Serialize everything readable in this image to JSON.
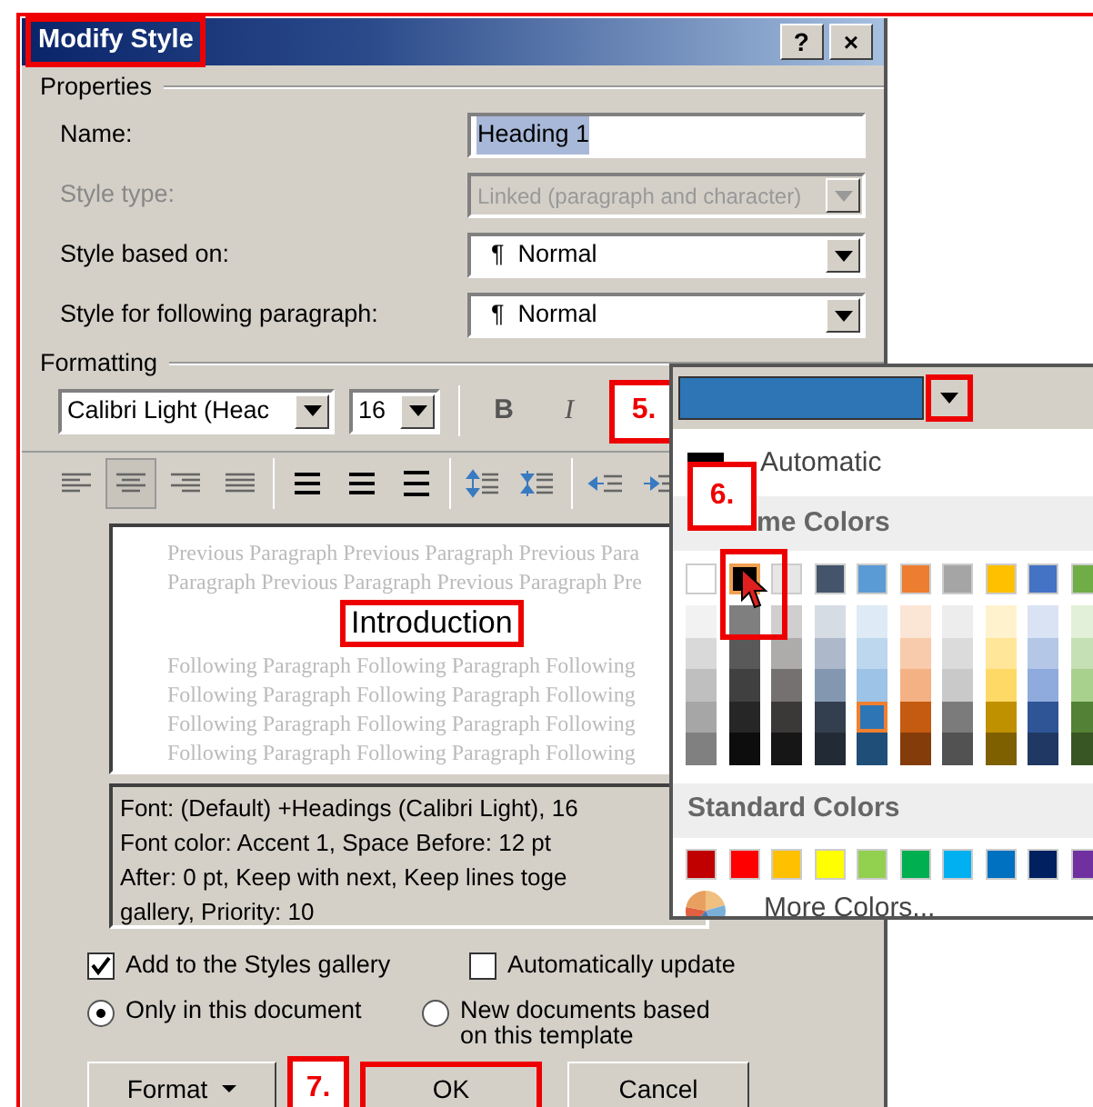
{
  "window": {
    "title": "Modify Style",
    "highlighted": true,
    "help_label": "?",
    "close_label": "×"
  },
  "properties": {
    "label": "Properties",
    "fields": [
      {
        "label": "Name:",
        "kind": "text",
        "value": "Heading 1",
        "disabled": false,
        "selected_text": true
      },
      {
        "label": "Style type:",
        "kind": "combo",
        "value": "Linked (paragraph and character)",
        "disabled": true
      },
      {
        "label": "Style based on:",
        "kind": "combo",
        "prefix": "¶",
        "value": "Normal",
        "disabled": false
      },
      {
        "label": "Style for following paragraph:",
        "kind": "combo",
        "prefix": "¶",
        "value": "Normal",
        "disabled": false
      }
    ]
  },
  "formatting": {
    "label": "Formatting",
    "font": "Calibri Light (Heac",
    "size": "16",
    "bold_label": "B",
    "italic_label": "I",
    "step_label": "5.",
    "tools": [
      {
        "kind": "align-left",
        "selected": false
      },
      {
        "kind": "align-center",
        "selected": true
      },
      {
        "kind": "align-right",
        "selected": false
      },
      {
        "kind": "justify",
        "selected": false
      },
      {
        "kind": "sep"
      },
      {
        "kind": "single-space",
        "selected": false
      },
      {
        "kind": "one-half-space",
        "selected": false
      },
      {
        "kind": "double-space",
        "selected": false
      },
      {
        "kind": "sep"
      },
      {
        "kind": "space-up",
        "selected": false
      },
      {
        "kind": "space-down",
        "selected": false
      },
      {
        "kind": "sep"
      },
      {
        "kind": "outdent",
        "selected": false
      },
      {
        "kind": "indent",
        "selected": false
      }
    ]
  },
  "preview": {
    "lines": [
      {
        "kind": "previous",
        "text": "Previous Paragraph Previous Paragraph Previous Para"
      },
      {
        "kind": "previous",
        "text": "Paragraph Previous Paragraph Previous Paragraph Pre"
      },
      {
        "kind": "heading",
        "text": "Introduction",
        "highlighted": true
      },
      {
        "kind": "following",
        "text": "Following Paragraph Following Paragraph Following"
      },
      {
        "kind": "following",
        "text": "Following Paragraph Following Paragraph Following"
      },
      {
        "kind": "following",
        "text": "Following Paragraph Following Paragraph Following"
      },
      {
        "kind": "following",
        "text": "Following Paragraph Following Paragraph Following"
      }
    ]
  },
  "description": [
    "Font: (Default) +Headings (Calibri Light), 16",
    "Font color: Accent 1, Space Before:  12 pt",
    "After:  0 pt, Keep with next, Keep lines toge",
    "gallery, Priority: 10"
  ],
  "checkboxes": [
    {
      "label": "Add to the Styles gallery",
      "checked": true
    },
    {
      "label": "Automatically update",
      "checked": false
    }
  ],
  "radios": [
    {
      "label": "Only in this document",
      "selected": true
    },
    {
      "label": "New documents based on this template",
      "selected": false
    }
  ],
  "buttons": [
    {
      "label": "Format",
      "kind": "menu",
      "highlighted": false
    },
    {
      "label": "OK",
      "kind": "default",
      "highlighted": true
    },
    {
      "label": "Cancel",
      "kind": "plain",
      "highlighted": false
    }
  ],
  "step_7_label": "7.",
  "color_popup": {
    "dropdown_highlighted": true,
    "automatic_label": "Automatic",
    "step_label": "6.",
    "theme_header": "me Colors",
    "theme_colors": [
      {
        "color": "#ffffff",
        "hovered": false,
        "shades": [
          {
            "color": "#f2f2f2",
            "selected": false
          },
          {
            "color": "#d9d9d9",
            "selected": false
          },
          {
            "color": "#bfbfbf",
            "selected": false
          },
          {
            "color": "#a6a6a6",
            "selected": false
          },
          {
            "color": "#808080",
            "selected": false
          }
        ]
      },
      {
        "color": "#000000",
        "hovered": true,
        "shades": [
          {
            "color": "#7f7f7f",
            "selected": false
          },
          {
            "color": "#595959",
            "selected": false
          },
          {
            "color": "#404040",
            "selected": false
          },
          {
            "color": "#262626",
            "selected": false
          },
          {
            "color": "#0d0d0d",
            "selected": false
          }
        ]
      },
      {
        "color": "#e7e6e6",
        "hovered": false,
        "shades": [
          {
            "color": "#d0cece",
            "selected": false
          },
          {
            "color": "#aeabab",
            "selected": false
          },
          {
            "color": "#757171",
            "selected": false
          },
          {
            "color": "#3b3838",
            "selected": false
          },
          {
            "color": "#171616",
            "selected": false
          }
        ]
      },
      {
        "color": "#44546a",
        "hovered": false,
        "shades": [
          {
            "color": "#d6dce4",
            "selected": false
          },
          {
            "color": "#adb9ca",
            "selected": false
          },
          {
            "color": "#8497b0",
            "selected": false
          },
          {
            "color": "#333f4f",
            "selected": false
          },
          {
            "color": "#222a35",
            "selected": false
          }
        ]
      },
      {
        "color": "#5b9bd5",
        "hovered": false,
        "shades": [
          {
            "color": "#deebf6",
            "selected": false
          },
          {
            "color": "#bdd7ee",
            "selected": false
          },
          {
            "color": "#9dc3e6",
            "selected": false
          },
          {
            "color": "#2e75b5",
            "selected": true
          },
          {
            "color": "#1f4e79",
            "selected": false
          }
        ]
      },
      {
        "color": "#ed7d31",
        "hovered": false,
        "shades": [
          {
            "color": "#fbe5d5",
            "selected": false
          },
          {
            "color": "#f7cbac",
            "selected": false
          },
          {
            "color": "#f4b183",
            "selected": false
          },
          {
            "color": "#c55a11",
            "selected": false
          },
          {
            "color": "#843c0b",
            "selected": false
          }
        ]
      },
      {
        "color": "#a5a5a5",
        "hovered": false,
        "shades": [
          {
            "color": "#ededed",
            "selected": false
          },
          {
            "color": "#dbdbdb",
            "selected": false
          },
          {
            "color": "#c9c9c9",
            "selected": false
          },
          {
            "color": "#7b7b7b",
            "selected": false
          },
          {
            "color": "#525252",
            "selected": false
          }
        ]
      },
      {
        "color": "#ffc000",
        "hovered": false,
        "shades": [
          {
            "color": "#fff2cc",
            "selected": false
          },
          {
            "color": "#ffe699",
            "selected": false
          },
          {
            "color": "#ffd966",
            "selected": false
          },
          {
            "color": "#bf9000",
            "selected": false
          },
          {
            "color": "#7f6000",
            "selected": false
          }
        ]
      },
      {
        "color": "#4472c4",
        "hovered": false,
        "shades": [
          {
            "color": "#dae3f3",
            "selected": false
          },
          {
            "color": "#b4c7e7",
            "selected": false
          },
          {
            "color": "#8faadc",
            "selected": false
          },
          {
            "color": "#2f5597",
            "selected": false
          },
          {
            "color": "#203864",
            "selected": false
          }
        ]
      },
      {
        "color": "#70ad47",
        "hovered": false,
        "shades": [
          {
            "color": "#e2f0d9",
            "selected": false
          },
          {
            "color": "#c5e0b4",
            "selected": false
          },
          {
            "color": "#a9d18e",
            "selected": false
          },
          {
            "color": "#538135",
            "selected": false
          },
          {
            "color": "#375623",
            "selected": false
          }
        ]
      }
    ],
    "standard_header": "Standard Colors",
    "standard_colors": [
      {
        "color": "#c00000"
      },
      {
        "color": "#ff0000"
      },
      {
        "color": "#ffc000"
      },
      {
        "color": "#ffff00"
      },
      {
        "color": "#92d050"
      },
      {
        "color": "#00b050"
      },
      {
        "color": "#00b0f0"
      },
      {
        "color": "#0070c0"
      },
      {
        "color": "#002060"
      },
      {
        "color": "#7030a0"
      }
    ],
    "more_label": "More Colors..."
  }
}
